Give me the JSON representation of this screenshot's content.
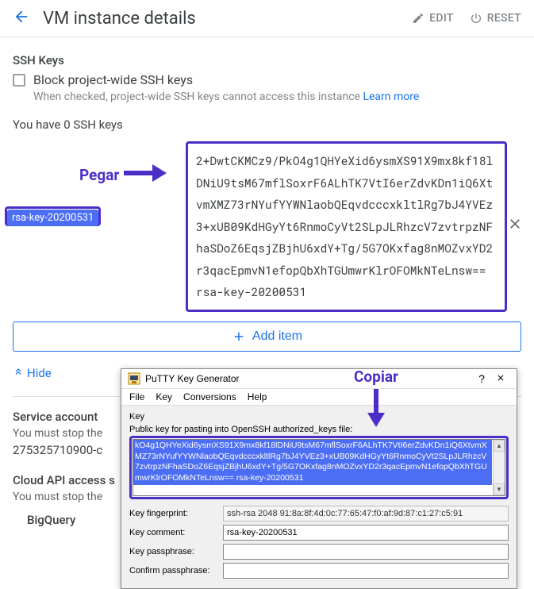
{
  "header": {
    "title": "VM instance details",
    "edit": "EDIT",
    "reset": "RESET"
  },
  "ssh": {
    "section": "SSH Keys",
    "block_label": "Block project-wide SSH keys",
    "block_helper": "When checked, project-wide SSH keys cannot access this instance ",
    "learn_more": "Learn more",
    "count_text": "You have 0 SSH keys",
    "key_name": "rsa-key-20200531",
    "key_body": "2+DwtCKMCz9/PkO4g1QHYeXid6ysmXS91X9mx8kf18lDNiU9tsM67mflSoxrF6ALhTK7VtI6erZdvKDn1iQ6XtvmXMZ73rNYufYYWNlaobQEqvdcccxkltlRg7bJ4YVEz3+xUB09KdHGyYt6RnmoCyVt2SLpJLRhzcV7zvtrpzNFhaSDoZ6EqsjZBjhU6xdY+Tg/5G7OKxfag8nMOZvxYD2r3qacEpmvN1efopQbXhTGUmwrKlrOFOMkNTeLnsw== rsa-key-20200531",
    "add_item": "Add item",
    "hide": "Hide"
  },
  "annotations": {
    "paste": "Pegar",
    "copy": "Copiar"
  },
  "service": {
    "label": "Service account",
    "stop_text": "You must stop the",
    "email": "275325710900-c"
  },
  "api": {
    "label": "Cloud API access s",
    "stop_text": "You must stop the",
    "bigquery": "BigQuery"
  },
  "putty": {
    "title": "PuTTY Key Generator",
    "menu": {
      "file": "File",
      "key": "Key",
      "conv": "Conversions",
      "help": "Help"
    },
    "group": "Key",
    "pubkey_label": "Public key for pasting into OpenSSH authorized_keys file:",
    "pubkey_value": "kO4g1QHYeXid6ysmXS91X9mx8kf18lDNiU9tsM67mflSoxrF6ALhTK7VtI6erZdvKDn1iQ6XtvmXMZ73rNYufYYWNlaobQEqvdcccxkltlRg7bJ4YVEz3+xUB09KdHGyYt6RnmoCyVt2SLpJLRhzcV7zvtrpzNFhaSDoZ6EqsjZBjhU6xdY+Tg/5G7OKxfag8nMOZvxYD2r3qacEpmvN1efopQbXhTGUmwrKlrOFOMkNTeLnsw== rsa-key-20200531",
    "fingerprint_label": "Key fingerprint:",
    "fingerprint_value": "ssh-rsa 2048 91:8a:8f:4d:0c:77:65:47:f0:af:9d:87:c1:27:c5:91",
    "comment_label": "Key comment:",
    "comment_value": "rsa-key-20200531",
    "passphrase_label": "Key passphrase:",
    "passphrase_value": "",
    "confirm_label": "Confirm passphrase:",
    "confirm_value": ""
  }
}
